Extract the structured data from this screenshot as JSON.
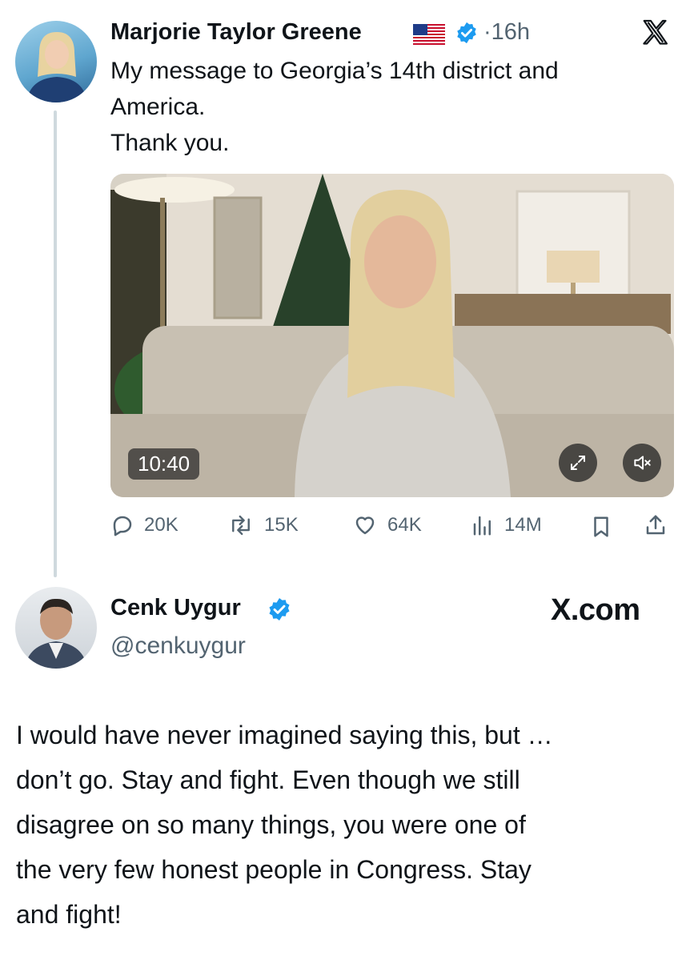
{
  "quoted_post": {
    "author_name": "Marjorie Taylor Greene",
    "flag_icon": "us-flag-icon",
    "verified_icon": "verified-badge-icon",
    "verified_color": "#1d9bf0",
    "time": "16h",
    "separator": "·",
    "platform_icon": "x-logo-icon",
    "text_lines": [
      "My message to Georgia’s 14th district and",
      "America.",
      "Thank you."
    ],
    "video": {
      "duration": "10:40",
      "expand_icon": "expand-icon",
      "mute_icon": "speaker-muted-icon"
    },
    "actions": {
      "replies": "20K",
      "reposts": "15K",
      "likes": "64K",
      "views": "14M"
    }
  },
  "reply_post": {
    "author_name": "Cenk Uygur",
    "verified_icon": "verified-badge-icon",
    "handle": "@cenkuygur",
    "site_label": "X.com",
    "text_lines": [
      "I would have never imagined saying this, but …",
      "don’t go. Stay and fight. Even though we still",
      "disagree on so many things, you were one of",
      "the very few honest people in Congress. Stay",
      "and fight!"
    ]
  },
  "colors": {
    "text_primary": "#0f1419",
    "text_secondary": "#536471",
    "thread_line": "#cfd9de"
  }
}
